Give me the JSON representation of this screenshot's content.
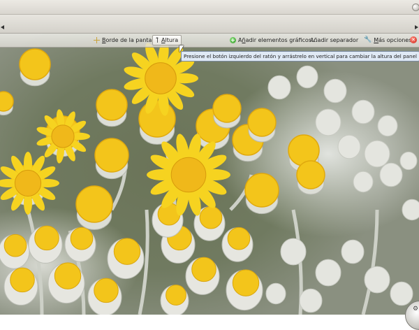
{
  "panel": {
    "items": [
      {
        "id": "screen-edge",
        "label": "Borde de la pantalla",
        "mnemonic_index": 0,
        "icon": "move-icon"
      },
      {
        "id": "height",
        "label": "Altura",
        "mnemonic_index": 0,
        "icon": "height-icon",
        "active": true
      },
      {
        "id": "add-widgets",
        "label": "Añadir elementos gráficos...",
        "mnemonic_index": 1,
        "icon": "add-icon"
      },
      {
        "id": "add-spacer",
        "label": "Añadir separador",
        "mnemonic_index": -1,
        "icon": ""
      },
      {
        "id": "more-options",
        "label": "Más opciones",
        "mnemonic_index": 0,
        "icon": "wrench-icon"
      }
    ],
    "close_icon": "close-icon"
  },
  "tooltip": {
    "text": "Presione el botón izquierdo del ratón y arrástrelo en vertical para cambiar la altura del panel"
  },
  "colors": {
    "panel": "#dcdad3",
    "tooltip_bg": "#dfe9f5",
    "flower": "#f3c51b",
    "add": "#2f9a25",
    "close": "#d0231a"
  }
}
